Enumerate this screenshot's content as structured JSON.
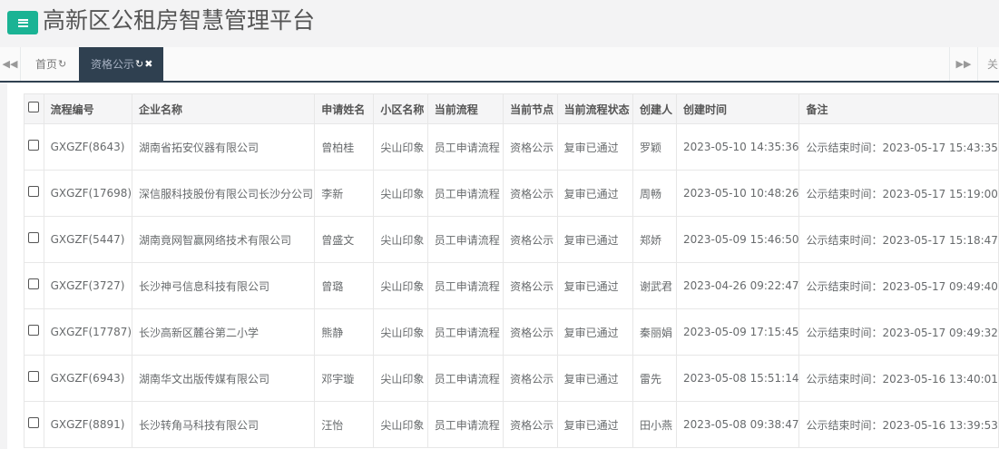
{
  "header": {
    "menu_icon": "hamburger-icon",
    "title": "高新区公租房智慧管理平台"
  },
  "tabs": {
    "left_nav_icon": "double-chevron-left-icon",
    "home": {
      "label": "首页",
      "icon": "refresh-icon"
    },
    "active": {
      "label": "资格公示",
      "icons": [
        "refresh-icon",
        "close-icon"
      ]
    },
    "right_nav_icon": "double-chevron-right-icon",
    "close_all_label": "关"
  },
  "colors": {
    "accent": "#1ab394",
    "active_tab_bg": "#2f4050"
  },
  "table": {
    "columns": [
      "流程编号",
      "企业名称",
      "申请姓名",
      "小区名称",
      "当前流程",
      "当前节点",
      "当前流程状态",
      "创建人",
      "创建时间",
      "备注"
    ],
    "rows": [
      [
        "GXGZF(8643)",
        "湖南省拓安仪器有限公司",
        "曾柏桂",
        "尖山印象",
        "员工申请流程",
        "资格公示",
        "复审已通过",
        "罗颖",
        "2023-05-10 14:35:36",
        "公示结束时间：2023-05-17 15:43:35"
      ],
      [
        "GXGZF(17698)",
        "深信服科技股份有限公司长沙分公司",
        "李新",
        "尖山印象",
        "员工申请流程",
        "资格公示",
        "复审已通过",
        "周畅",
        "2023-05-10 10:48:26",
        "公示结束时间：2023-05-17 15:19:00"
      ],
      [
        "GXGZF(5447)",
        "湖南竟网智赢网络技术有限公司",
        "曾盛文",
        "尖山印象",
        "员工申请流程",
        "资格公示",
        "复审已通过",
        "郑娇",
        "2023-05-09 15:46:50",
        "公示结束时间：2023-05-17 15:18:47"
      ],
      [
        "GXGZF(3727)",
        "长沙神弓信息科技有限公司",
        "曾璐",
        "尖山印象",
        "员工申请流程",
        "资格公示",
        "复审已通过",
        "谢武君",
        "2023-04-26 09:22:47",
        "公示结束时间：2023-05-17 09:49:40"
      ],
      [
        "GXGZF(17787)",
        "长沙高新区麓谷第二小学",
        "熊静",
        "尖山印象",
        "员工申请流程",
        "资格公示",
        "复审已通过",
        "秦丽娟",
        "2023-05-09 17:15:45",
        "公示结束时间：2023-05-17 09:49:32"
      ],
      [
        "GXGZF(6943)",
        "湖南华文出版传媒有限公司",
        "邓宇璇",
        "尖山印象",
        "员工申请流程",
        "资格公示",
        "复审已通过",
        "雷先",
        "2023-05-08 15:51:14",
        "公示结束时间：2023-05-16 13:40:01"
      ],
      [
        "GXGZF(8891)",
        "长沙转角马科技有限公司",
        "汪怡",
        "尖山印象",
        "员工申请流程",
        "资格公示",
        "复审已通过",
        "田小燕",
        "2023-05-08 09:38:47",
        "公示结束时间：2023-05-16 13:39:53"
      ]
    ]
  }
}
